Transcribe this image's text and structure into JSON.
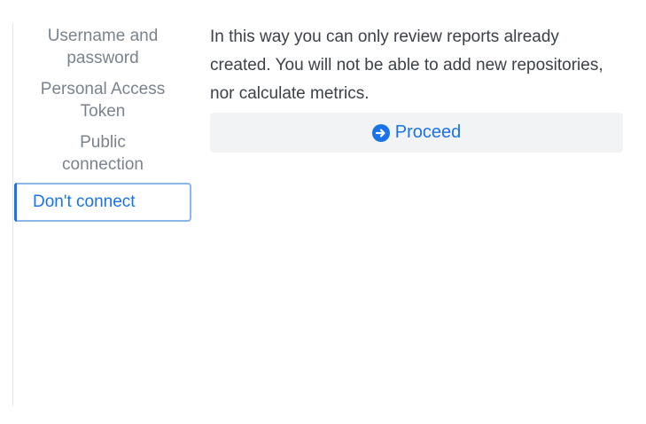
{
  "sidebar": {
    "items": [
      {
        "label_line1": "Username and",
        "label_line2": "password"
      },
      {
        "label_line1": "Personal Access",
        "label_line2": "Token"
      },
      {
        "label_line1": "Public",
        "label_line2": "connection"
      },
      {
        "label_line1": "Don't connect",
        "label_line2": ""
      }
    ],
    "active_index": 3
  },
  "content": {
    "message_line1": "In this way you can only review reports already",
    "message_line2": "created. You will not be able to add new repositories,",
    "message_line3": "nor calculate metrics.",
    "proceed_label": "Proceed",
    "proceed_icon": "arrow-right-circle-icon"
  },
  "colors": {
    "accent": "#1a73e8",
    "active_border": "#8ab6ea",
    "nav_text": "#7a838d",
    "body_text": "#3c4148",
    "button_bg": "#f2f3f5"
  }
}
